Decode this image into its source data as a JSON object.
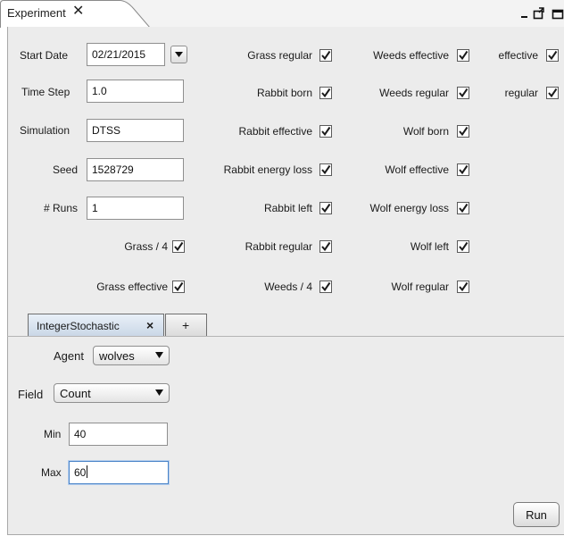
{
  "tab": {
    "title": "Experiment",
    "close_glyph": "✕"
  },
  "window_controls": [
    "minimize-icon",
    "undock-icon",
    "maximize-icon"
  ],
  "form": {
    "start_date": {
      "label": "Start Date",
      "value": "02/21/2015"
    },
    "time_step": {
      "label": "Time Step",
      "value": "1.0"
    },
    "simulation": {
      "label": "Simulation",
      "value": "DTSS"
    },
    "seed": {
      "label": "Seed",
      "value": "1528729"
    },
    "runs": {
      "label": "# Runs",
      "value": "1"
    }
  },
  "checks": {
    "grass_regular": {
      "label": "Grass regular",
      "checked": true
    },
    "weeds_effective": {
      "label": "Weeds effective",
      "checked": true
    },
    "effective": {
      "label": "effective",
      "checked": true
    },
    "rabbit_born": {
      "label": "Rabbit born",
      "checked": true
    },
    "weeds_regular": {
      "label": "Weeds regular",
      "checked": true
    },
    "regular": {
      "label": "regular",
      "checked": true
    },
    "rabbit_effective": {
      "label": "Rabbit effective",
      "checked": true
    },
    "wolf_born": {
      "label": "Wolf born",
      "checked": true
    },
    "rabbit_energy_loss": {
      "label": "Rabbit energy loss",
      "checked": true
    },
    "wolf_effective": {
      "label": "Wolf effective",
      "checked": true
    },
    "rabbit_left": {
      "label": "Rabbit left",
      "checked": true
    },
    "wolf_energy_loss": {
      "label": "Wolf energy loss",
      "checked": true
    },
    "grass_4": {
      "label": "Grass / 4",
      "checked": true
    },
    "rabbit_regular": {
      "label": "Rabbit regular",
      "checked": true
    },
    "wolf_left": {
      "label": "Wolf left",
      "checked": true
    },
    "grass_effective": {
      "label": "Grass effective",
      "checked": true
    },
    "weeds_4": {
      "label": "Weeds / 4",
      "checked": true
    },
    "wolf_regular": {
      "label": "Wolf regular",
      "checked": true
    }
  },
  "subtabs": {
    "active": "IntegerStochastic",
    "close_glyph": "×",
    "add": "+"
  },
  "stochastic": {
    "agent": {
      "label": "Agent",
      "value": "wolves"
    },
    "field": {
      "label": "Field",
      "value": "Count"
    },
    "min": {
      "label": "Min",
      "value": "40"
    },
    "max": {
      "label": "Max",
      "value": "60"
    }
  },
  "run_label": "Run"
}
